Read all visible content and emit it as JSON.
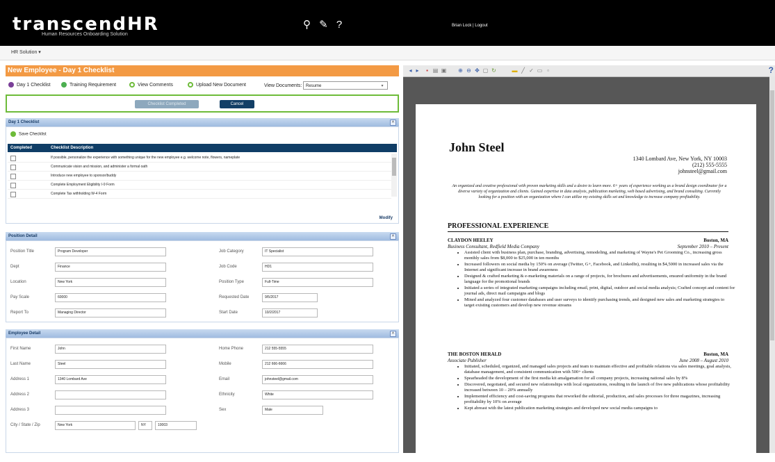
{
  "header": {
    "logo": "transcendHR",
    "tagline": "Human Resources Onboarding Solution",
    "icons": [
      "run-icon",
      "tag-icon",
      "help-icon"
    ],
    "user_name": "Brian Lock",
    "logout": "Logout"
  },
  "menu": {
    "label": "HR Solution ▾"
  },
  "checklist_page": {
    "title": "New Employee - Day 1 Checklist",
    "tabs": [
      {
        "label": "Day 1 Checklist",
        "color": "#7a3f98"
      },
      {
        "label": "Training Requirement",
        "color": "#4caf50"
      },
      {
        "label": "View Comments",
        "color": "#6dbb39"
      },
      {
        "label": "Upload New Document",
        "color": "#6dbb39"
      }
    ],
    "view_documents_label": "View Documents:",
    "view_documents_value": "Resume",
    "checklist_completed_button": "Checklist Completed",
    "cancel_button": "Cancel"
  },
  "day1_section": {
    "title": "Day 1 Checklist",
    "save_label": "Save Checklist",
    "columns": [
      "Completed",
      "Checklist Description"
    ],
    "rows": [
      "If possible, personalize the experience with something unique for the new employee e.g. welcome note, flowers, nameplate",
      "Communicate vision and mission, and administer a formal oath",
      "Introduce new employee to sponsor/buddy",
      "Complete Employment Eligibility I-9 Form",
      "Complete Tax withholding W-4 Form"
    ],
    "modify": "Modify"
  },
  "position_section": {
    "title": "Position Detail",
    "fields": {
      "position_title": {
        "label": "Position Title",
        "value": "Program Developer"
      },
      "dept": {
        "label": "Dept",
        "value": "Finance"
      },
      "location": {
        "label": "Location",
        "value": "New York"
      },
      "pay_scale": {
        "label": "Pay Scale",
        "value": "60000"
      },
      "report_to": {
        "label": "Report To",
        "value": "Managing Director"
      },
      "job_category": {
        "label": "Job Category",
        "value": "IT Specialist"
      },
      "job_code": {
        "label": "Job Code",
        "value": "HD1"
      },
      "position_type": {
        "label": "Position Type",
        "value": "Full-Time"
      },
      "requested_date": {
        "label": "Requested Date",
        "value": "9/5/2017"
      },
      "start_date": {
        "label": "Start Date",
        "value": "10/2/2017"
      }
    }
  },
  "employee_section": {
    "title": "Employee Detail",
    "fields": {
      "first_name": {
        "label": "First Name",
        "value": "John"
      },
      "last_name": {
        "label": "Last Name",
        "value": "Steel"
      },
      "address1": {
        "label": "Address 1",
        "value": "1340 Lombard Ave"
      },
      "address2": {
        "label": "Address 2",
        "value": ""
      },
      "address3": {
        "label": "Address 3",
        "value": ""
      },
      "city_state_zip": {
        "label": "City / State / Zip",
        "city": "New York",
        "state": "NY",
        "zip": "10003"
      },
      "home_phone": {
        "label": "Home Phone",
        "value": "212 555-5555"
      },
      "mobile": {
        "label": "Mobile",
        "value": "212 666-6666"
      },
      "email": {
        "label": "Email",
        "value": "johnsteel@gmail.com"
      },
      "ethnicity": {
        "label": "Ethnicity",
        "value": "White"
      },
      "sex": {
        "label": "Sex",
        "value": "Male"
      }
    }
  },
  "resume": {
    "name": "John Steel",
    "contact": [
      "1340 Lombard Ave, New York, NY 10003",
      "(212) 555-5555",
      "johnsteel@gmail.com"
    ],
    "summary": "An organized and creative professional with proven marketing skills and a desire to learn more. 6+ years of experience working as a brand design coordinator for a diverse variety of organization and clients. Gained expertise in data analysis, publication marketing, web based advertising, and brand consulting. Currently looking for a position with an organization where I can utilize my existing skills set and knowledge to increase company profitability.",
    "section_title": "PROFESSIONAL EXPERIENCE",
    "jobs": [
      {
        "company": "CLAYDON HEELEY",
        "location": "Boston, MA",
        "role": "Business Consultant, Redfield Media Company",
        "dates": "September 2010 – Present",
        "bullets": [
          "Assisted client with business plan, purchase, branding, advertising, remodeling, and marketing of Wayne's Pet Grooming Co., increasing gross monthly sales from $8,000 to $25,000 in ten months",
          "Increased followers on social media by 150% on average (Twitter, G+, Facebook, and LinkedIn), resulting in $4,5000 in increased sales via the Internet and significant increase in brand awareness",
          "Designed & crafted marketing & e-marketing materials on a range of projects, for brochures and advertisements, ensured uniformity in the brand language for the promotional brands",
          "Initiated a series of integrated marketing campaigns including email, print, digital, outdoor and social media analysis; Crafted concept and content for journal ads, direct mail campaigns and blogs",
          "Mined and analyzed four customer databases and user surveys to identify purchasing trends, and designed new sales and marketing strategies to target existing customers and develop new revenue streams"
        ]
      },
      {
        "company": "THE BOSTON HERALD",
        "location": "Boston, MA",
        "role": "Associate Publisher",
        "dates": "June 2008 – August 2010",
        "bullets": [
          "Initiated, scheduled, organized, and managed sales projects and team to maintain effective and profitable relations via sales meetings, goal analysis, database management, and consistent communication with 500+ clients",
          "Spearheaded the development of the first media kit amalgamation for all company projects, increasing national sales by 8%",
          "Discovered, negotiated, and secured new relationships with local organizations, resulting in the launch of five new publications whose profitability increased between 10 – 20% annually",
          "Implemented efficiency and cost-saving programs that reworked the editorial, production, and sales processes for three magazines, increasing profitability by 10% on average",
          "Kept abreast with the latest publication marketing strategies and developed new social media campaigns to"
        ]
      }
    ]
  }
}
